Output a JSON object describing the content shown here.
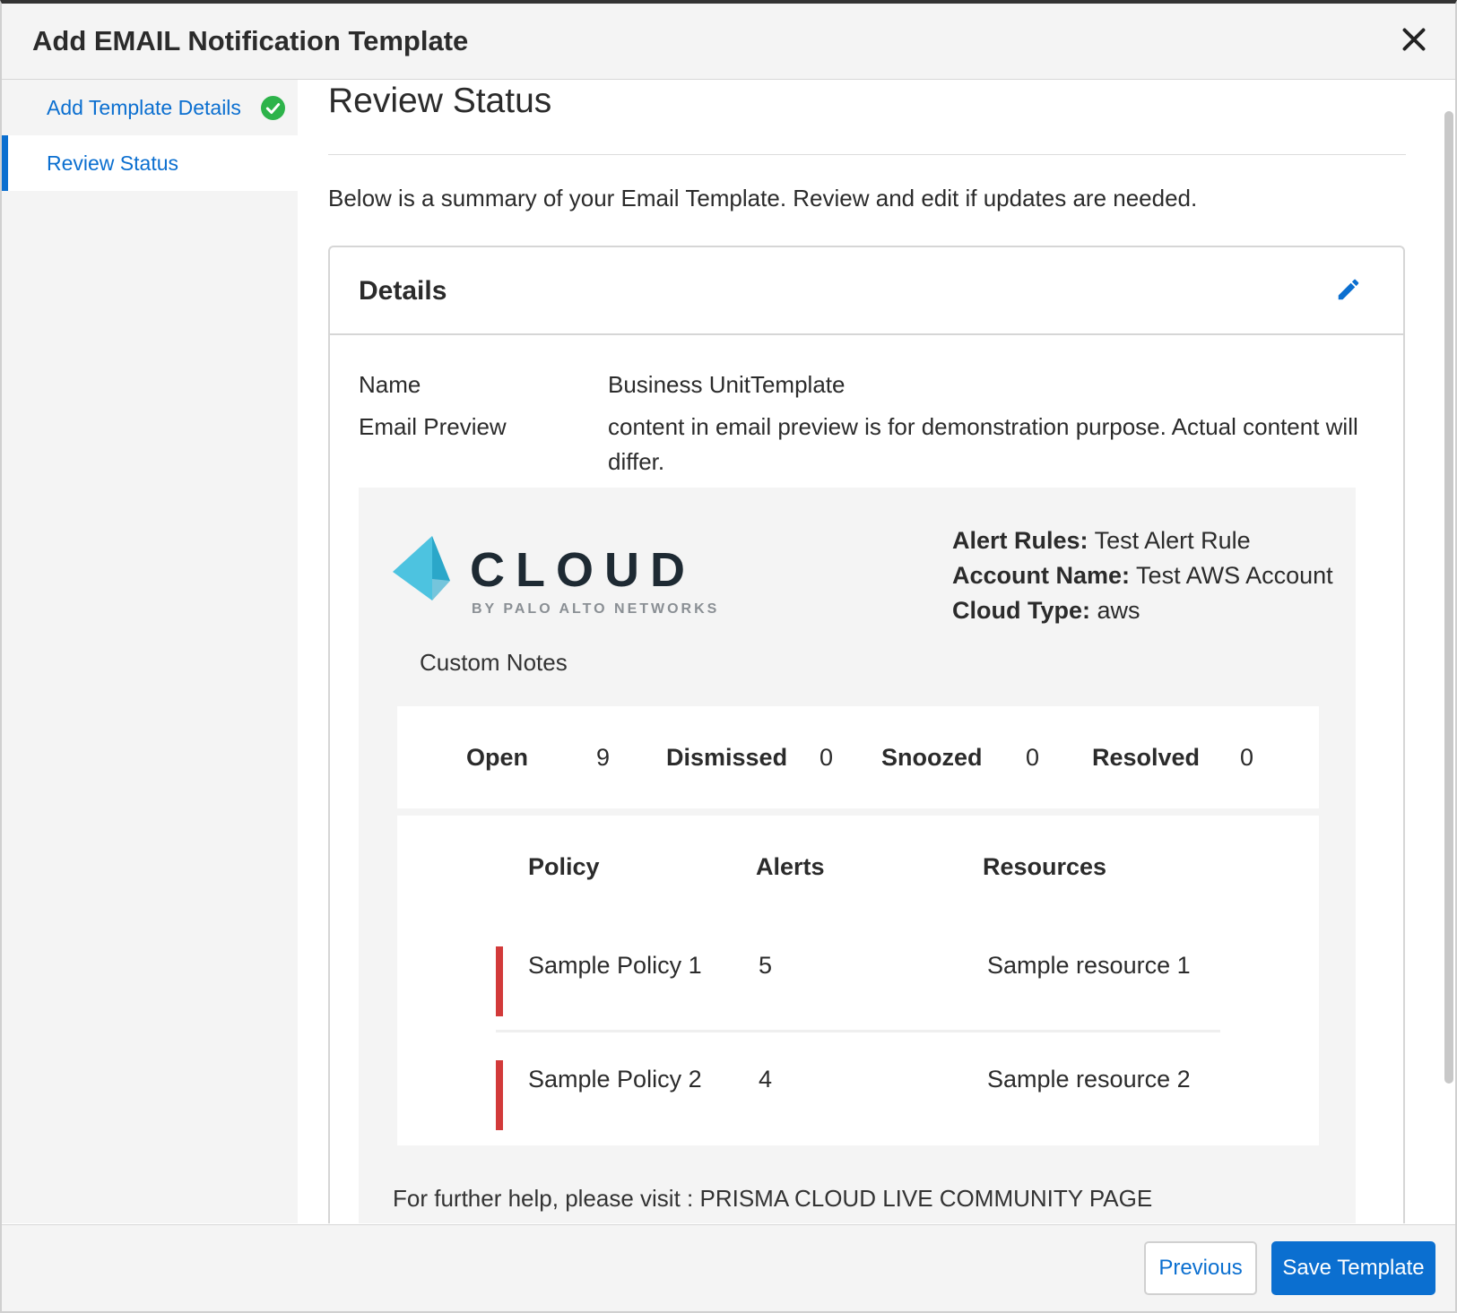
{
  "modal": {
    "title": "Add EMAIL Notification Template",
    "close_icon": "close-icon"
  },
  "sidebar": {
    "items": [
      {
        "label": "Add Template Details",
        "status": "completed",
        "icon": "check-circle-icon"
      },
      {
        "label": "Review Status",
        "status": "active"
      }
    ]
  },
  "main": {
    "title": "Review Status",
    "intro": "Below is a summary of your Email Template. Review and edit if updates are needed."
  },
  "details": {
    "title": "Details",
    "edit_icon": "pencil-icon",
    "name_label": "Name",
    "name_value": "Business UnitTemplate",
    "preview_label": "Email Preview",
    "preview_value": "content in email preview is for demonstration purpose. Actual content will differ."
  },
  "email_preview": {
    "logo_word": "CLOUD",
    "logo_sub": "BY PALO ALTO NETWORKS",
    "alert_rules_label": "Alert Rules:",
    "alert_rules_value": "Test Alert Rule",
    "account_name_label": "Account Name:",
    "account_name_value": "Test AWS Account",
    "cloud_type_label": "Cloud Type:",
    "cloud_type_value": "aws",
    "custom_notes": "Custom Notes",
    "counts": [
      {
        "label": "Open",
        "value": "9"
      },
      {
        "label": "Dismissed",
        "value": "0"
      },
      {
        "label": "Snoozed",
        "value": "0"
      },
      {
        "label": "Resolved",
        "value": "0"
      }
    ],
    "table_headers": [
      "Policy",
      "Alerts",
      "Resources"
    ],
    "rows": [
      {
        "policy": "Sample Policy 1",
        "alerts": "5",
        "resource": "Sample resource 1"
      },
      {
        "policy": "Sample Policy 2",
        "alerts": "4",
        "resource": "Sample resource 2"
      }
    ],
    "footer_text": "For further help, please visit : PRISMA CLOUD LIVE COMMUNITY PAGE"
  },
  "footer": {
    "previous_label": "Previous",
    "save_label": "Save Template"
  },
  "colors": {
    "accent": "#0b6fd0",
    "success": "#2db34a",
    "severity": "#d23a3a",
    "logo_cyan": "#4dc3e0",
    "logo_text": "#1e2a33"
  }
}
